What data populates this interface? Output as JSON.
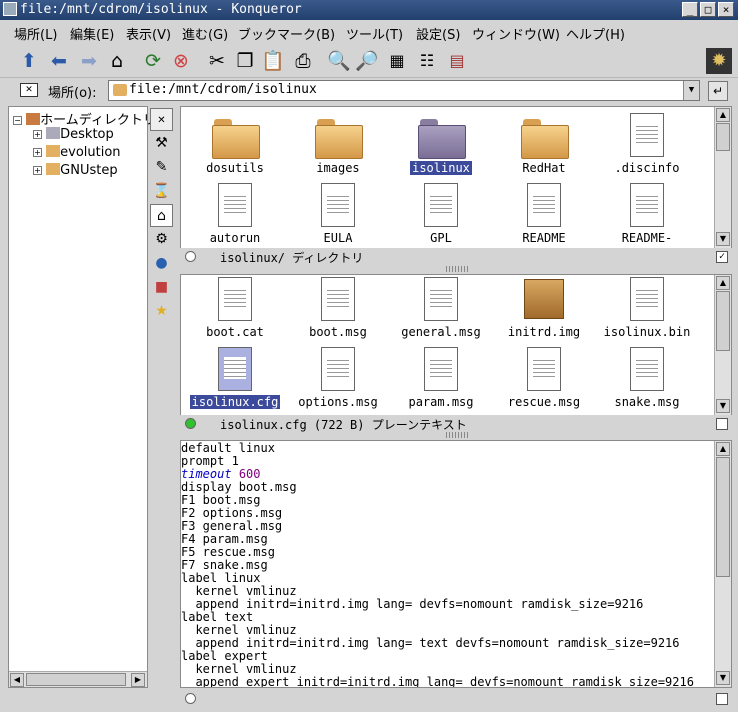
{
  "window": {
    "title": "file:/mnt/cdrom/isolinux - Konqueror",
    "minimize": "_",
    "maximize": "□",
    "close": "×"
  },
  "menu": [
    "場所(L)",
    "編集(E)",
    "表示(V)",
    "進む(G)",
    "ブックマーク(B)",
    "ツール(T)",
    "設定(S)",
    "ウィンドウ(W)",
    "ヘルプ(H)"
  ],
  "location": {
    "label": "場所(o):",
    "value": "file:/mnt/cdrom/isolinux"
  },
  "tree": {
    "root": "ホームディレクトリ",
    "items": [
      "Desktop",
      "evolution",
      "GNUstep"
    ]
  },
  "pane_top": {
    "items": [
      {
        "name": "dosutils",
        "type": "folder"
      },
      {
        "name": "images",
        "type": "folder"
      },
      {
        "name": "isolinux",
        "type": "folder",
        "selected": true
      },
      {
        "name": "RedHat",
        "type": "folder"
      },
      {
        "name": ".discinfo",
        "type": "file"
      },
      {
        "name": "autorun",
        "type": "exec"
      },
      {
        "name": "EULA",
        "type": "file"
      },
      {
        "name": "GPL",
        "type": "file"
      },
      {
        "name": "README",
        "type": "file"
      },
      {
        "name": "README-",
        "type": "file"
      }
    ],
    "status": "isolinux/  ディレクトリ"
  },
  "pane_mid": {
    "items": [
      {
        "name": "boot.cat",
        "type": "file"
      },
      {
        "name": "boot.msg",
        "type": "file"
      },
      {
        "name": "general.msg",
        "type": "file"
      },
      {
        "name": "initrd.img",
        "type": "package"
      },
      {
        "name": "isolinux.bin",
        "type": "file"
      },
      {
        "name": "isolinux.cfg",
        "type": "file",
        "selected": true
      },
      {
        "name": "options.msg",
        "type": "file"
      },
      {
        "name": "param.msg",
        "type": "file"
      },
      {
        "name": "rescue.msg",
        "type": "file"
      },
      {
        "name": "snake.msg",
        "type": "file"
      }
    ],
    "status": "isolinux.cfg (722 B)  プレーンテキスト"
  },
  "text_lines": [
    "default linux",
    "prompt 1",
    "timeout 600",
    "display boot.msg",
    "F1 boot.msg",
    "F2 options.msg",
    "F3 general.msg",
    "F4 param.msg",
    "F5 rescue.msg",
    "F7 snake.msg",
    "label linux",
    "  kernel vmlinuz",
    "  append initrd=initrd.img lang= devfs=nomount ramdisk_size=9216",
    "label text",
    "  kernel vmlinuz",
    "  append initrd=initrd.img lang= text devfs=nomount ramdisk_size=9216",
    "label expert",
    "  kernel vmlinuz",
    "  append expert initrd=initrd.img lang= devfs=nomount ramdisk_size=9216"
  ]
}
